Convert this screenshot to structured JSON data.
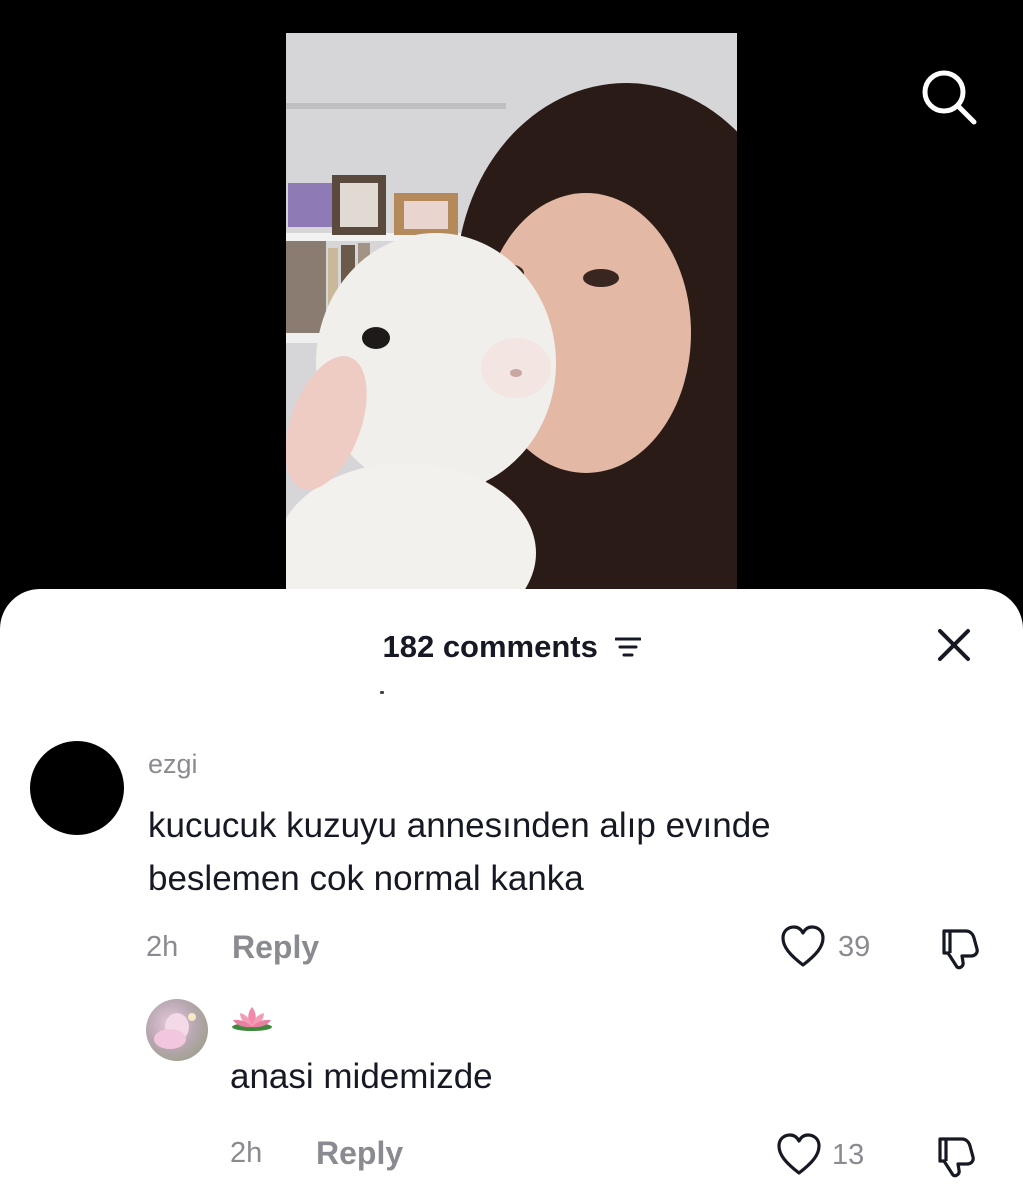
{
  "video": {
    "thumbnail_icon": "video-thumbnail-girl-with-lamb",
    "search_icon": "search-icon"
  },
  "comments_header": {
    "title": "182 comments",
    "filter_icon": "filter-icon",
    "close_icon": "close-icon"
  },
  "comments": [
    {
      "username": "ezgi",
      "text": "kucucuk kuzuyu annesınden alıp evınde beslemen cok normal kanka",
      "time": "2h",
      "reply_label": "Reply",
      "likes": "39"
    },
    {
      "username_icon": "lotus-emoji",
      "text": "anasi midemizde",
      "time": "2h",
      "reply_label": "Reply",
      "likes": "13"
    }
  ]
}
